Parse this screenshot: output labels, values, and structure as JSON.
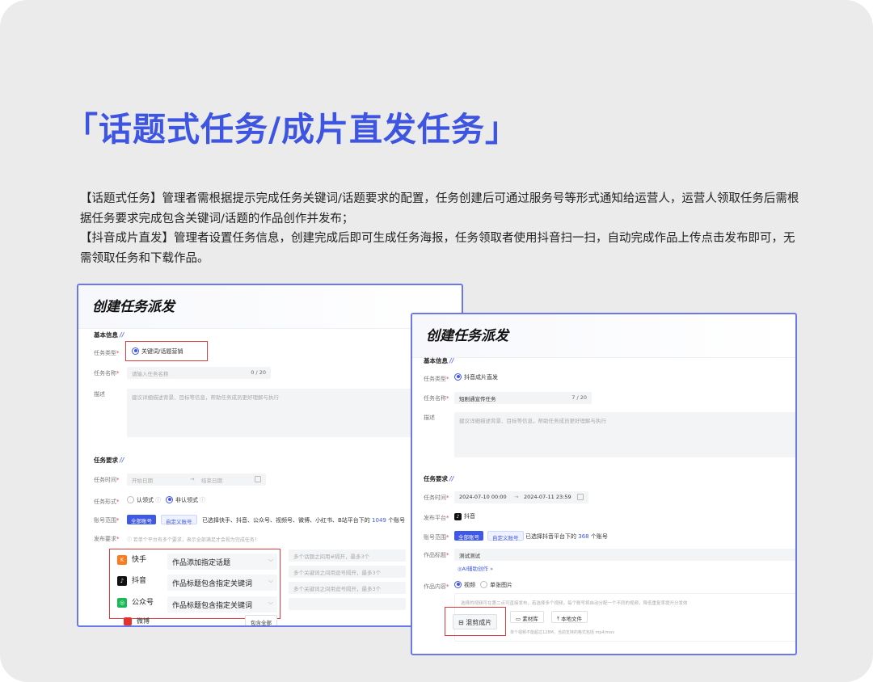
{
  "page": {
    "title": "「话题式任务/成片直发任务」",
    "desc_lines": [
      "【话题式任务】管理者需根据提示完成任务关键词/话题要求的配置，任务创建后可通过服务号等形式通知给运营人，运营人领取任务后需根据任务要求完成包含关键词/话题的作品创作并发布；",
      "【抖音成片直发】管理者设置任务信息，创建完成后即可生成任务海报，任务领取者使用抖音扫一扫，自动完成作品上传点击发布即可，无需领取任务和下载作品。"
    ]
  },
  "left_form": {
    "title": "创建任务派发",
    "basic_section": "基本信息",
    "task_type_label": "任务类型",
    "task_type_value": "关键词/话题营销",
    "task_name_label": "任务名称",
    "task_name_placeholder": "请输入任务名称",
    "task_name_count": "0 / 20",
    "desc_label": "描述",
    "desc_placeholder": "建议详细描述背景、目标等信息，帮助任务成员更好理解与执行",
    "req_section": "任务要求",
    "time_label": "任务时间",
    "start_placeholder": "开始日期",
    "arrow": "→",
    "end_placeholder": "结束日期",
    "form_label": "任务形式",
    "form_opt1": "认领式",
    "form_opt2": "非认领式",
    "scope_label": "账号范围",
    "scope_tag_all": "全部账号",
    "scope_tag_custom": "自定义账号",
    "scope_text": "已选择快手、抖音、公众号、视频号、微博、小红书、B站平台下的",
    "scope_count": "1049",
    "scope_unit": "个账号",
    "publish_label": "发布要求",
    "publish_hint": "若单个平台有多个要求，表示全部满足才会视为完成任务！",
    "platforms": [
      {
        "name": "快手",
        "req": "作品添加指定话题",
        "color": "#ff7a1a",
        "icon": "K"
      },
      {
        "name": "抖音",
        "req": "作品标题包含指定关键词",
        "color": "#111111",
        "icon": "♪"
      },
      {
        "name": "公众号",
        "req": "作品标题包含指定关键词",
        "color": "#19b955",
        "icon": "◎"
      }
    ],
    "right_hints": [
      "多个话题之间用#隔开，最多3个",
      "多个关键词之间用逗号隔开，最多3个",
      "多个关键词之间用逗号隔开，最多3个"
    ],
    "partial_row": "微博",
    "partial_btn": "包含全部"
  },
  "right_form": {
    "title": "创建任务派发",
    "basic_section": "基本信息",
    "task_type_label": "任务类型",
    "task_type_value": "抖音成片直发",
    "task_name_label": "任务名称",
    "task_name_value": "短剧通宣传任务",
    "task_name_count": "7 / 20",
    "desc_label": "描述",
    "desc_placeholder": "建议详细描述背景、目标等信息，帮助任务成员更好理解与执行",
    "req_section": "任务要求",
    "time_label": "任务时间",
    "start_value": "2024-07-10 00:00",
    "arrow": "→",
    "end_value": "2024-07-11 23:59",
    "platform_label": "发布平台",
    "platform_value": "抖音",
    "scope_label": "账号范围",
    "scope_tag_all": "全部账号",
    "scope_tag_custom": "自定义账号",
    "scope_text": "已选择抖音平台下的",
    "scope_count": "368",
    "scope_unit": "个账号",
    "work_title_label": "作品标题",
    "work_title_value": "测试测试",
    "ai_link": "AI辅助创作 »",
    "content_label": "作品内容",
    "content_opt1": "视频",
    "content_opt2": "单张图片",
    "upload_hint": "选择的视频可在第二点可直接发布，若选择多个视频，每个账号将自动分配一个不同的视频，降低重复率提升分发效",
    "btn_mix": "混剪成片",
    "btn_library": "素材库",
    "btn_local": "本地文件",
    "file_hint": "单个视频不能超过128M，当前支持的格式包括 mp4/mov"
  }
}
